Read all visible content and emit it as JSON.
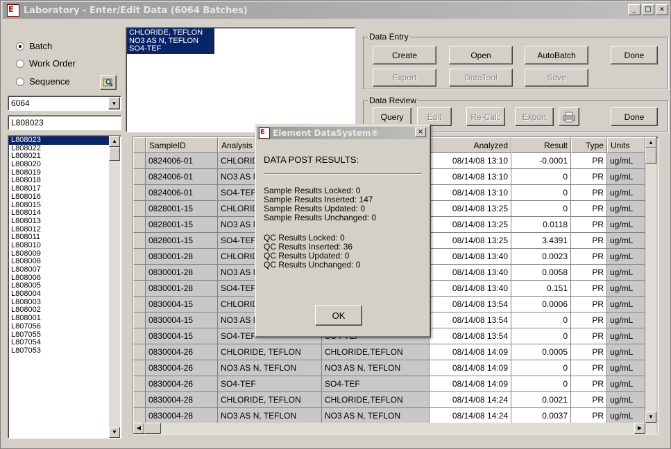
{
  "window": {
    "title": "Laboratory - Enter/Edit Data (6064 Batches)"
  },
  "mode": {
    "options": [
      {
        "label": "Batch",
        "checked": true
      },
      {
        "label": "Work Order",
        "checked": false
      },
      {
        "label": "Sequence",
        "checked": false
      }
    ]
  },
  "batch_select": {
    "value": "6064"
  },
  "batch_text": {
    "value": "L808023"
  },
  "batch_list": {
    "items": [
      "L808023",
      "L808022",
      "L808021",
      "L808020",
      "L808019",
      "L808018",
      "L808017",
      "L808016",
      "L808015",
      "L808014",
      "L808013",
      "L808012",
      "L808011",
      "L808010",
      "L808009",
      "L808008",
      "L808007",
      "L808006",
      "L808005",
      "L808004",
      "L808003",
      "L808002",
      "L808001",
      "L807056",
      "L807055",
      "L807054",
      "L807053"
    ],
    "selected_index": 0
  },
  "analysis_list": {
    "items": [
      "CHLORIDE, TEFLON",
      "NO3 AS N, TEFLON",
      "SO4-TEF"
    ]
  },
  "data_entry": {
    "label": "Data Entry",
    "create": "Create",
    "open": "Open",
    "autobatch": "AutoBatch",
    "done": "Done",
    "export": "Export",
    "datatool": "DataTool",
    "save": "Save"
  },
  "data_review": {
    "label": "Data Review",
    "query": "Query",
    "edit": "Edit",
    "recalc": "Re-Calc",
    "export": "Export",
    "print_icon": "printer-icon",
    "done": "Done"
  },
  "grid": {
    "columns": [
      "SampleID",
      "Analysis",
      "",
      "Analyzed",
      "Result",
      "Type",
      "Units"
    ],
    "rows": [
      {
        "sample": "0824006-01",
        "analysis": "CHLORIDE, TEFLON",
        "analysis2": "CHLORIDE,TEFLON",
        "analyzed": "08/14/08 13:10",
        "result": "-0.0001",
        "type": "PR",
        "units": "ug/mL"
      },
      {
        "sample": "0824006-01",
        "analysis": "NO3 AS N, TEFLON",
        "analysis2": "NO3 AS N, TEFLON",
        "analyzed": "08/14/08 13:10",
        "result": "0",
        "type": "PR",
        "units": "ug/mL"
      },
      {
        "sample": "0824006-01",
        "analysis": "SO4-TEF",
        "analysis2": "SO4-TEF",
        "analyzed": "08/14/08 13:10",
        "result": "0",
        "type": "PR",
        "units": "ug/mL"
      },
      {
        "sample": "0828001-15",
        "analysis": "CHLORIDE, TEFLON",
        "analysis2": "CHLORIDE,TEFLON",
        "analyzed": "08/14/08 13:25",
        "result": "0",
        "type": "PR",
        "units": "ug/mL"
      },
      {
        "sample": "0828001-15",
        "analysis": "NO3 AS N, TEFLON",
        "analysis2": "NO3 AS N, TEFLON",
        "analyzed": "08/14/08 13:25",
        "result": "0.0118",
        "type": "PR",
        "units": "ug/mL"
      },
      {
        "sample": "0828001-15",
        "analysis": "SO4-TEF",
        "analysis2": "SO4-TEF",
        "analyzed": "08/14/08 13:25",
        "result": "3.4391",
        "type": "PR",
        "units": "ug/mL"
      },
      {
        "sample": "0830001-28",
        "analysis": "CHLORIDE, TEFLON",
        "analysis2": "CHLORIDE,TEFLON",
        "analyzed": "08/14/08 13:40",
        "result": "0.0023",
        "type": "PR",
        "units": "ug/mL"
      },
      {
        "sample": "0830001-28",
        "analysis": "NO3 AS N, TEFLON",
        "analysis2": "NO3 AS N, TEFLON",
        "analyzed": "08/14/08 13:40",
        "result": "0.0058",
        "type": "PR",
        "units": "ug/mL"
      },
      {
        "sample": "0830001-28",
        "analysis": "SO4-TEF",
        "analysis2": "SO4-TEF",
        "analyzed": "08/14/08 13:40",
        "result": "0.151",
        "type": "PR",
        "units": "ug/mL"
      },
      {
        "sample": "0830004-15",
        "analysis": "CHLORIDE, TEFLON",
        "analysis2": "CHLORIDE,TEFLON",
        "analyzed": "08/14/08 13:54",
        "result": "0.0006",
        "type": "PR",
        "units": "ug/mL"
      },
      {
        "sample": "0830004-15",
        "analysis": "NO3 AS N, TEFLON",
        "analysis2": "NO3 AS N, TEFLON",
        "analyzed": "08/14/08 13:54",
        "result": "0",
        "type": "PR",
        "units": "ug/mL"
      },
      {
        "sample": "0830004-15",
        "analysis": "SO4-TEF",
        "analysis2": "SO4-TEF",
        "analyzed": "08/14/08 13:54",
        "result": "0",
        "type": "PR",
        "units": "ug/mL"
      },
      {
        "sample": "0830004-26",
        "analysis": "CHLORIDE, TEFLON",
        "analysis2": "CHLORIDE,TEFLON",
        "analyzed": "08/14/08 14:09",
        "result": "0.0005",
        "type": "PR",
        "units": "ug/mL"
      },
      {
        "sample": "0830004-26",
        "analysis": "NO3 AS N, TEFLON",
        "analysis2": "NO3 AS N, TEFLON",
        "analyzed": "08/14/08 14:09",
        "result": "0",
        "type": "PR",
        "units": "ug/mL"
      },
      {
        "sample": "0830004-26",
        "analysis": "SO4-TEF",
        "analysis2": "SO4-TEF",
        "analyzed": "08/14/08 14:09",
        "result": "0",
        "type": "PR",
        "units": "ug/mL"
      },
      {
        "sample": "0830004-28",
        "analysis": "CHLORIDE, TEFLON",
        "analysis2": "CHLORIDE,TEFLON",
        "analyzed": "08/14/08 14:24",
        "result": "0.0021",
        "type": "PR",
        "units": "ug/mL"
      },
      {
        "sample": "0830004-28",
        "analysis": "NO3 AS N, TEFLON",
        "analysis2": "NO3 AS N, TEFLON",
        "analyzed": "08/14/08 14:24",
        "result": "0.0037",
        "type": "PR",
        "units": "ug/mL"
      }
    ]
  },
  "dialog": {
    "title": "Element DataSystem®",
    "heading": "DATA POST RESULTS:",
    "lines": [
      "Sample Results Locked: 0",
      "Sample Results Inserted: 147",
      "Sample Results Updated: 0",
      "Sample Results Unchanged: 0",
      "QC Results Locked: 0",
      "QC Results Inserted: 36",
      "QC Results Updated: 0",
      "QC Results Unchanged: 0"
    ],
    "ok": "OK"
  }
}
